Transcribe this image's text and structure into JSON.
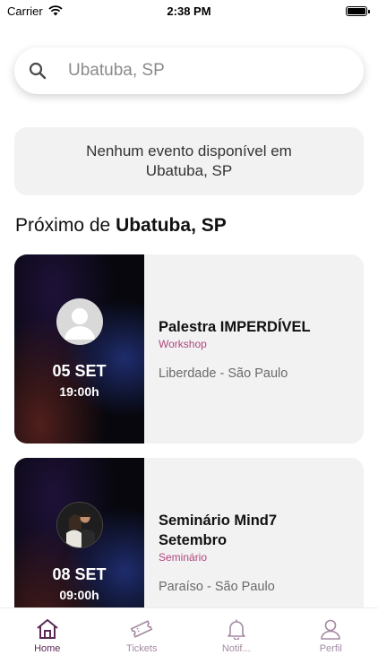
{
  "status_bar": {
    "carrier": "Carrier",
    "time": "2:38 PM"
  },
  "search": {
    "value": "Ubatuba, SP",
    "icon": "search-icon"
  },
  "notice": {
    "text": "Nenhum evento disponível em Ubatuba, SP"
  },
  "section": {
    "prefix": "Próximo de",
    "city": "Ubatuba, SP"
  },
  "events": [
    {
      "day": "05 SET",
      "hour": "19:00h",
      "title": "Palestra IMPERDÍVEL",
      "category": "Workshop",
      "place": "Liberdade - São Paulo",
      "avatar": "placeholder-avatar"
    },
    {
      "day": "08 SET",
      "hour": "09:00h",
      "title": "Seminário Mind7 Setembro",
      "category": "Seminário",
      "place": "Paraíso - São Paulo",
      "avatar": "couple-photo"
    }
  ],
  "tabs": [
    {
      "label": "Home",
      "icon": "home-icon",
      "active": true
    },
    {
      "label": "Tickets",
      "icon": "ticket-icon",
      "active": false
    },
    {
      "label": "Notif...",
      "icon": "bell-icon",
      "active": false
    },
    {
      "label": "Perfil",
      "icon": "user-icon",
      "active": false
    }
  ],
  "colors": {
    "accent": "#5b2a57",
    "category": "#b0457e",
    "inactive_tab": "#a48aa0",
    "card_bg": "#f2f2f2"
  }
}
